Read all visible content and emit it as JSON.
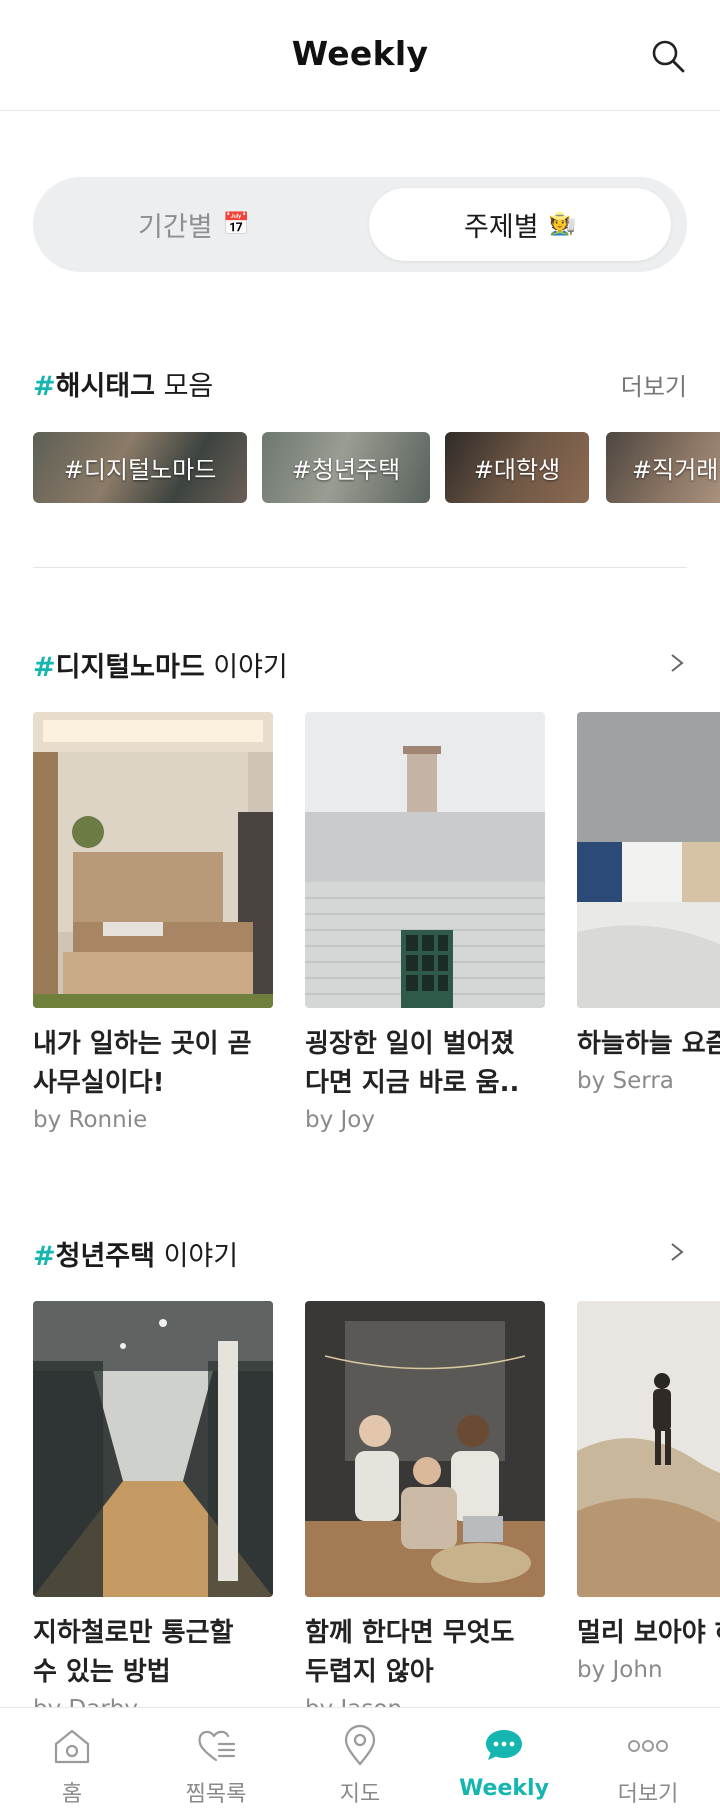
{
  "header": {
    "title": "Weekly"
  },
  "segment": {
    "tabs": [
      {
        "label": "기간별",
        "emoji": "📅"
      },
      {
        "label": "주제별",
        "emoji": "🧑‍🌾"
      }
    ]
  },
  "hashtags": {
    "title_hash": "#",
    "title_bold": "해시태그",
    "title_rest": " 모음",
    "more": "더보기",
    "chips": [
      "#디지털노마드",
      "#청년주택",
      "#대학생",
      "#직거래"
    ]
  },
  "section1": {
    "title_hash": "#",
    "title_bold": "디지털노마드",
    "title_rest": " 이야기",
    "cards": [
      {
        "title1": "내가 일하는 곳이 곧",
        "title2": "사무실이다!",
        "author": "by Ronnie"
      },
      {
        "title1": "굉장한 일이 벌어졌",
        "title2": "다면  지금 바로 움..",
        "author": "by Joy"
      },
      {
        "title1": "하늘하늘 요즘",
        "title2": "",
        "author": "by Serra"
      }
    ]
  },
  "section2": {
    "title_hash": "#",
    "title_bold": "청년주택",
    "title_rest": " 이야기",
    "cards": [
      {
        "title1": "지하철로만 통근할",
        "title2": "수 있는 방법",
        "author": "by Darby"
      },
      {
        "title1": "함께 한다면 무엇도",
        "title2": "두렵지 않아",
        "author": "by Jason"
      },
      {
        "title1": "멀리 보아야 하",
        "title2": "",
        "author": "by John"
      }
    ]
  },
  "nav": {
    "items": [
      {
        "label": "홈"
      },
      {
        "label": "찜목록"
      },
      {
        "label": "지도"
      },
      {
        "label": "Weekly"
      },
      {
        "label": "더보기"
      }
    ]
  },
  "colors": {
    "accent": "#15b5b0",
    "muted": "#8a8a8a"
  }
}
